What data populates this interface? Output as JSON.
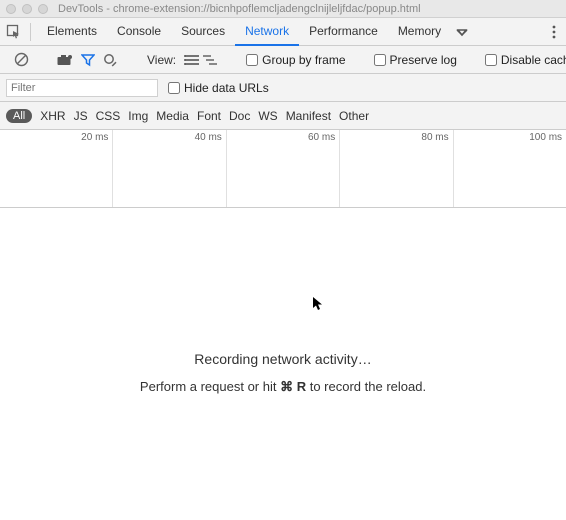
{
  "window": {
    "title": "DevTools - chrome-extension://bicnhpoflemcljadengclnijleljfdac/popup.html"
  },
  "tabs": {
    "items": [
      "Elements",
      "Console",
      "Sources",
      "Network",
      "Performance",
      "Memory"
    ],
    "active_index": 3
  },
  "toolbar": {
    "view_label": "View:",
    "group_by_frame": "Group by frame",
    "preserve_log": "Preserve log",
    "disable_cache": "Disable cache"
  },
  "filter": {
    "placeholder": "Filter",
    "hide_data_urls": "Hide data URLs"
  },
  "types": {
    "all": "All",
    "items": [
      "XHR",
      "JS",
      "CSS",
      "Img",
      "Media",
      "Font",
      "Doc",
      "WS",
      "Manifest",
      "Other"
    ]
  },
  "timeline": {
    "ticks": [
      "20 ms",
      "40 ms",
      "60 ms",
      "80 ms",
      "100 ms"
    ]
  },
  "messages": {
    "recording": "Recording network activity…",
    "hint_prefix": "Perform a request or hit ",
    "hint_key_mod": "⌘",
    "hint_key": "R",
    "hint_suffix": " to record the reload."
  }
}
